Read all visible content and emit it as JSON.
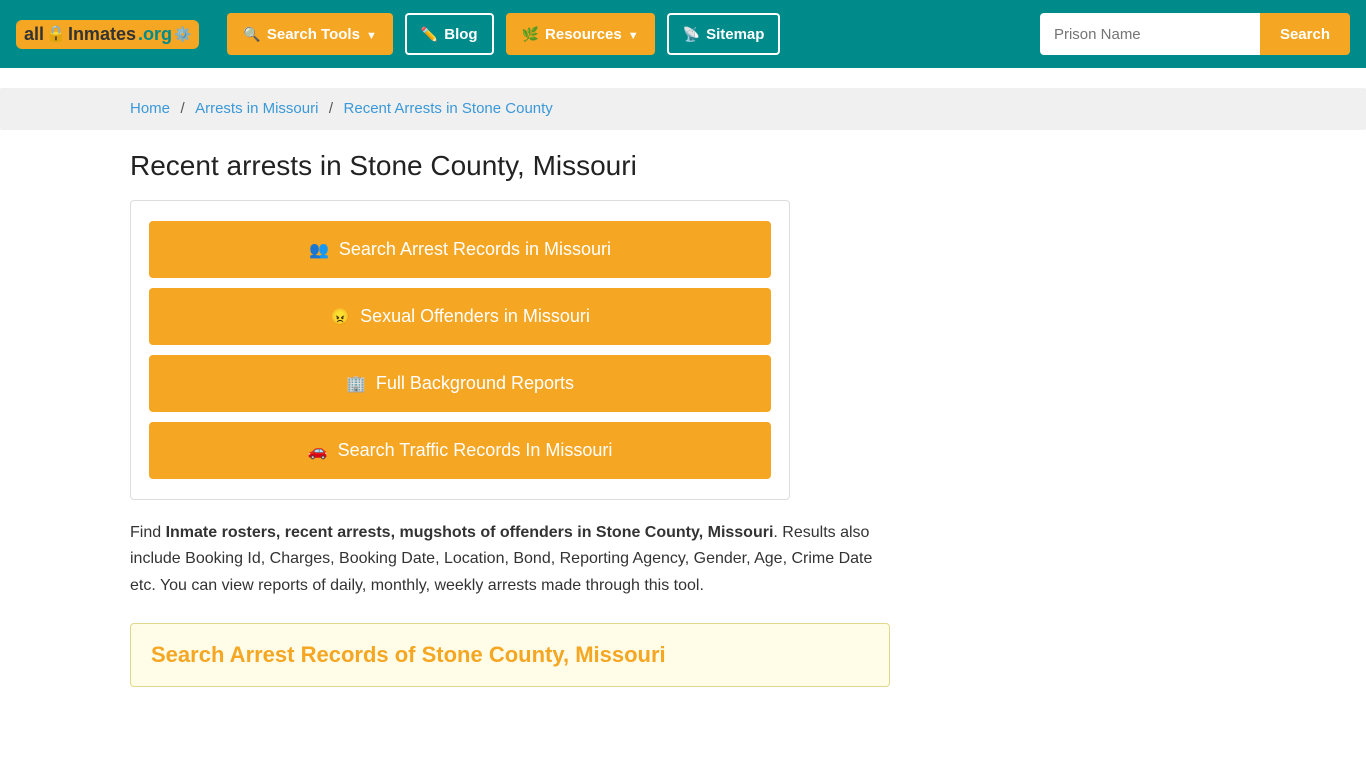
{
  "site": {
    "logo_all": "all",
    "logo_inmates": "Inmates",
    "logo_org": ".org"
  },
  "navbar": {
    "search_tools_label": "Search Tools",
    "blog_label": "Blog",
    "resources_label": "Resources",
    "sitemap_label": "Sitemap",
    "search_placeholder": "Prison Name",
    "search_button_label": "Search"
  },
  "breadcrumb": {
    "home": "Home",
    "arrests_in_missouri": "Arrests in Missouri",
    "current": "Recent Arrests in Stone County"
  },
  "page": {
    "title": "Recent arrests in Stone County, Missouri"
  },
  "action_buttons": [
    {
      "id": "arrest-records",
      "icon": "people",
      "label": "Search Arrest Records in Missouri"
    },
    {
      "id": "sexual-offenders",
      "icon": "angry",
      "label": "Sexual Offenders in Missouri"
    },
    {
      "id": "background-reports",
      "icon": "building",
      "label": "Full Background Reports"
    },
    {
      "id": "traffic-records",
      "icon": "car",
      "label": "Search Traffic Records In Missouri"
    }
  ],
  "description": {
    "prefix": "Find ",
    "bold_text": "Inmate rosters, recent arrests, mugshots of offenders in Stone County, Missouri",
    "suffix": ". Results also include Booking Id, Charges, Booking Date, Location, Bond, Reporting Agency, Gender, Age, Crime Date etc. You can view reports of daily, monthly, weekly arrests made through this tool."
  },
  "bottom_section": {
    "title": "Search Arrest Records of Stone County, Missouri"
  }
}
